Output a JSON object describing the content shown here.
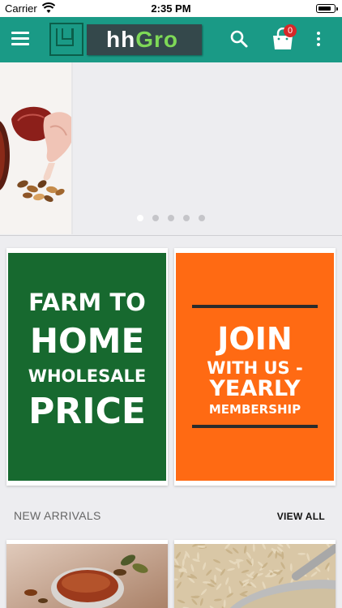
{
  "status_bar": {
    "carrier": "Carrier",
    "time": "2:35 PM",
    "battery_level": 0.85
  },
  "app_bar": {
    "brand_prefix": "hh",
    "brand_suffix": "Gro",
    "cart_count": "0",
    "icons": [
      "menu-icon",
      "logo-icon",
      "search-icon",
      "cart-icon",
      "more-vert-icon"
    ],
    "color": "#1a9a86"
  },
  "carousel": {
    "slide_count": 5,
    "active_index": 0
  },
  "banners": [
    {
      "lines": [
        "FARM TO",
        "HOME",
        "WHOLESALE",
        "PRICE"
      ],
      "color": "#17692f"
    },
    {
      "lines": [
        "JOIN",
        "WITH US -",
        "YEARLY",
        "MEMBERSHIP"
      ],
      "color": "#ff6a13"
    }
  ],
  "new_arrivals": {
    "title": "NEW ARRIVALS",
    "view_all": "VIEW ALL"
  }
}
